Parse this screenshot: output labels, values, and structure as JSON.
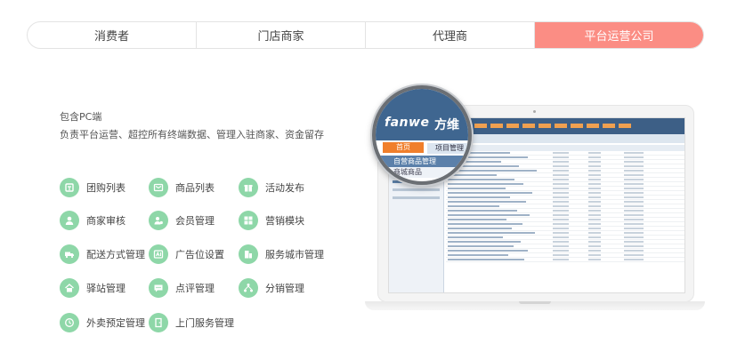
{
  "tabs": [
    {
      "label": "消费者",
      "active": false
    },
    {
      "label": "门店商家",
      "active": false
    },
    {
      "label": "代理商",
      "active": false
    },
    {
      "label": "平台运营公司",
      "active": true
    }
  ],
  "intro": {
    "title": "包含PC端",
    "description": "负责平台运营、超控所有终端数据、管理入驻商家、资金留存"
  },
  "features": [
    {
      "label": "团购列表",
      "icon": "group-buy-icon"
    },
    {
      "label": "商品列表",
      "icon": "product-list-icon"
    },
    {
      "label": "活动发布",
      "icon": "gift-icon"
    },
    {
      "label": "商家审核",
      "icon": "merchant-review-icon"
    },
    {
      "label": "会员管理",
      "icon": "member-icon"
    },
    {
      "label": "营销模块",
      "icon": "marketing-grid-icon"
    },
    {
      "label": "配送方式管理",
      "icon": "delivery-truck-icon"
    },
    {
      "label": "广告位设置",
      "icon": "ad-slot-icon"
    },
    {
      "label": "服务城市管理",
      "icon": "city-building-icon"
    },
    {
      "label": "驿站管理",
      "icon": "station-house-icon"
    },
    {
      "label": "点评管理",
      "icon": "comment-bubble-icon"
    },
    {
      "label": "分销管理",
      "icon": "distribution-network-icon"
    },
    {
      "label": "外卖预定管理",
      "icon": "clock-icon"
    },
    {
      "label": "上门服务管理",
      "icon": "door-icon"
    }
  ],
  "screenshot": {
    "logo": "fanwe",
    "logo_cn": "方维",
    "home_tab": "首页",
    "project_tab": "项目管理",
    "section": "自营商品管理",
    "subsection": "商城商品"
  },
  "colors": {
    "accent": "#fb8d84",
    "icon_green": "#8ed7a8",
    "admin_blue": "#3f6690"
  }
}
